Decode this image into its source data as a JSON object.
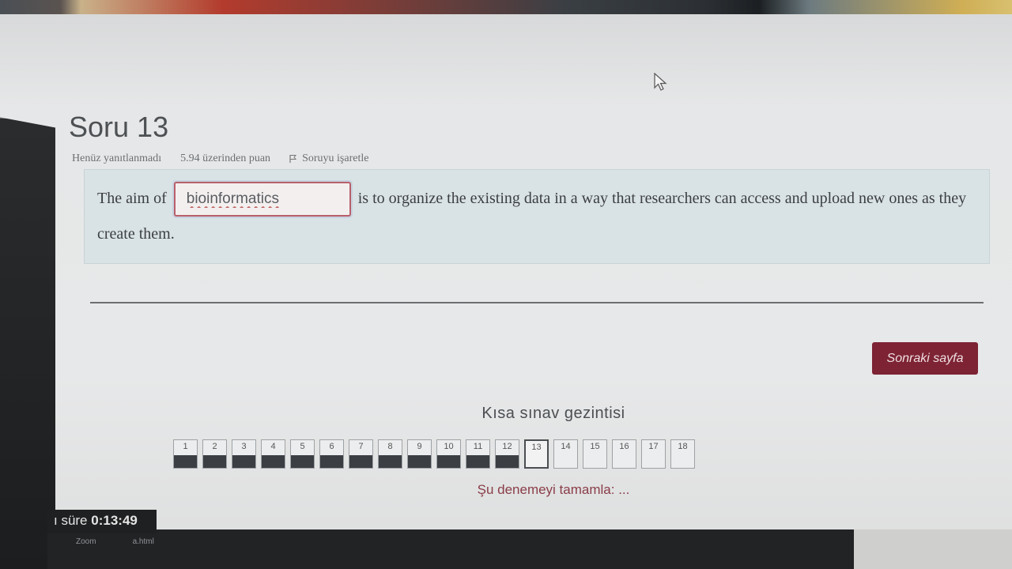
{
  "question": {
    "title": "Soru 13",
    "status": "Henüz yanıtlanmadı",
    "points": "5.94 üzerinden puan",
    "flag_label": "Soruyu işaretle",
    "text_before": "The aim of",
    "answer_value": "bioinformatics",
    "text_after": "is to organize the existing data in a way that researchers can access and upload new ones as they create them."
  },
  "actions": {
    "next_page": "Sonraki sayfa"
  },
  "navigation": {
    "title": "Kısa sınav gezintisi",
    "buttons": [
      {
        "label": "1",
        "state": "answered"
      },
      {
        "label": "2",
        "state": "answered"
      },
      {
        "label": "3",
        "state": "answered"
      },
      {
        "label": "4",
        "state": "answered"
      },
      {
        "label": "5",
        "state": "answered"
      },
      {
        "label": "6",
        "state": "answered"
      },
      {
        "label": "7",
        "state": "answered"
      },
      {
        "label": "8",
        "state": "answered"
      },
      {
        "label": "9",
        "state": "answered"
      },
      {
        "label": "10",
        "state": "answered"
      },
      {
        "label": "11",
        "state": "answered"
      },
      {
        "label": "12",
        "state": "answered"
      },
      {
        "label": "13",
        "state": "current"
      },
      {
        "label": "14",
        "state": "empty"
      },
      {
        "label": "15",
        "state": "empty"
      },
      {
        "label": "16",
        "state": "empty"
      },
      {
        "label": "17",
        "state": "empty"
      },
      {
        "label": "18",
        "state": "empty"
      }
    ],
    "finish_link": "Şu denemeyi tamamla: ..."
  },
  "timer": {
    "label": "ı süre",
    "value": "0:13:49"
  },
  "taskbar": {
    "items": [
      "Zoom",
      "a.html"
    ]
  },
  "colors": {
    "accent": "#7d2334",
    "question_bg": "#d9e2e5",
    "answered_fill": "#3b3f43"
  }
}
